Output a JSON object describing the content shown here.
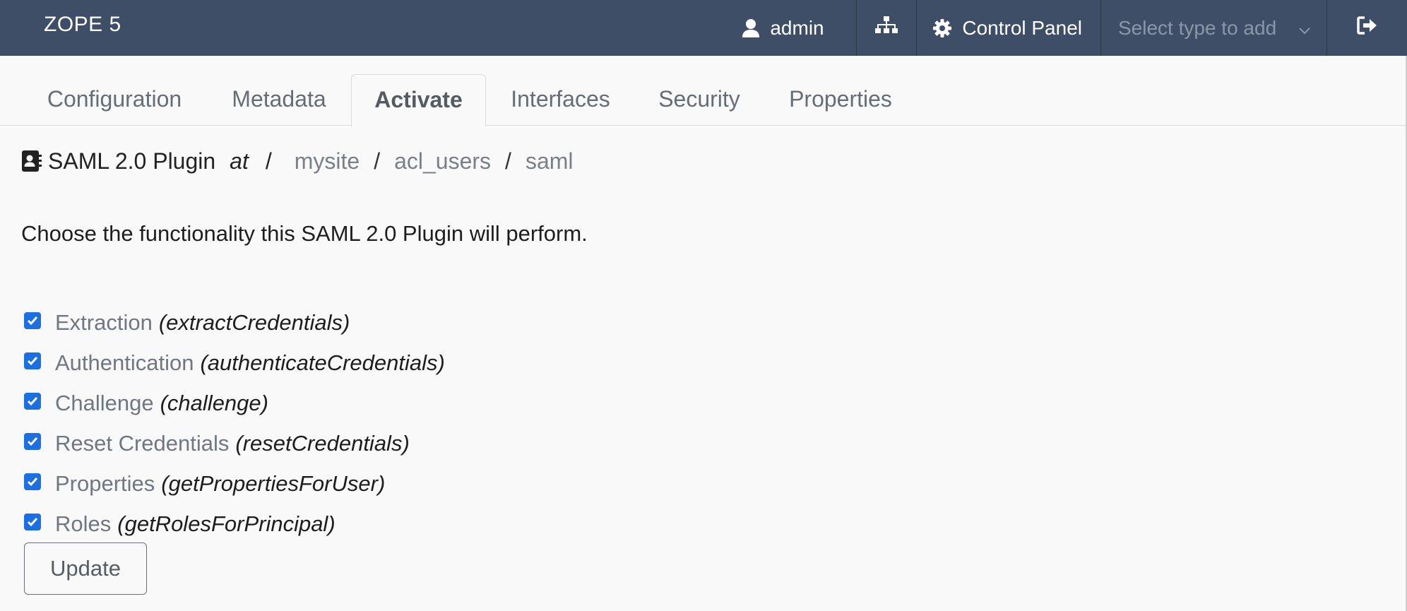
{
  "navbar": {
    "brand": "ZOPE 5",
    "user_label": "admin",
    "control_panel_label": "Control Panel",
    "select_placeholder": "Select type to add",
    "icons": {
      "user": "user-icon",
      "sitemap": "sitemap-icon",
      "gear": "gear-icon",
      "chevron": "chevron-down-icon",
      "logout": "logout-icon"
    },
    "colors": {
      "background": "#3d4e66",
      "text": "#ffffff",
      "placeholder": "#8b97a8"
    }
  },
  "tabs": [
    {
      "label": "Configuration",
      "active": false
    },
    {
      "label": "Metadata",
      "active": false
    },
    {
      "label": "Activate",
      "active": true
    },
    {
      "label": "Interfaces",
      "active": false
    },
    {
      "label": "Security",
      "active": false
    },
    {
      "label": "Properties",
      "active": false
    }
  ],
  "breadcrumb": {
    "title": "SAML 2.0 Plugin",
    "at": "at",
    "root_sep": "/",
    "crumbs": [
      "mysite",
      "acl_users",
      "saml"
    ],
    "separator": "/"
  },
  "intro": "Choose the functionality this SAML 2.0 Plugin will perform.",
  "options": [
    {
      "label": "Extraction",
      "method": "(extractCredentials)",
      "checked": true
    },
    {
      "label": "Authentication",
      "method": "(authenticateCredentials)",
      "checked": true
    },
    {
      "label": "Challenge",
      "method": "(challenge)",
      "checked": true
    },
    {
      "label": "Reset Credentials",
      "method": "(resetCredentials)",
      "checked": true
    },
    {
      "label": "Properties",
      "method": "(getPropertiesForUser)",
      "checked": true
    },
    {
      "label": "Roles",
      "method": "(getRolesForPrincipal)",
      "checked": true
    }
  ],
  "update_label": "Update",
  "accent_color": "#1b6fe3"
}
